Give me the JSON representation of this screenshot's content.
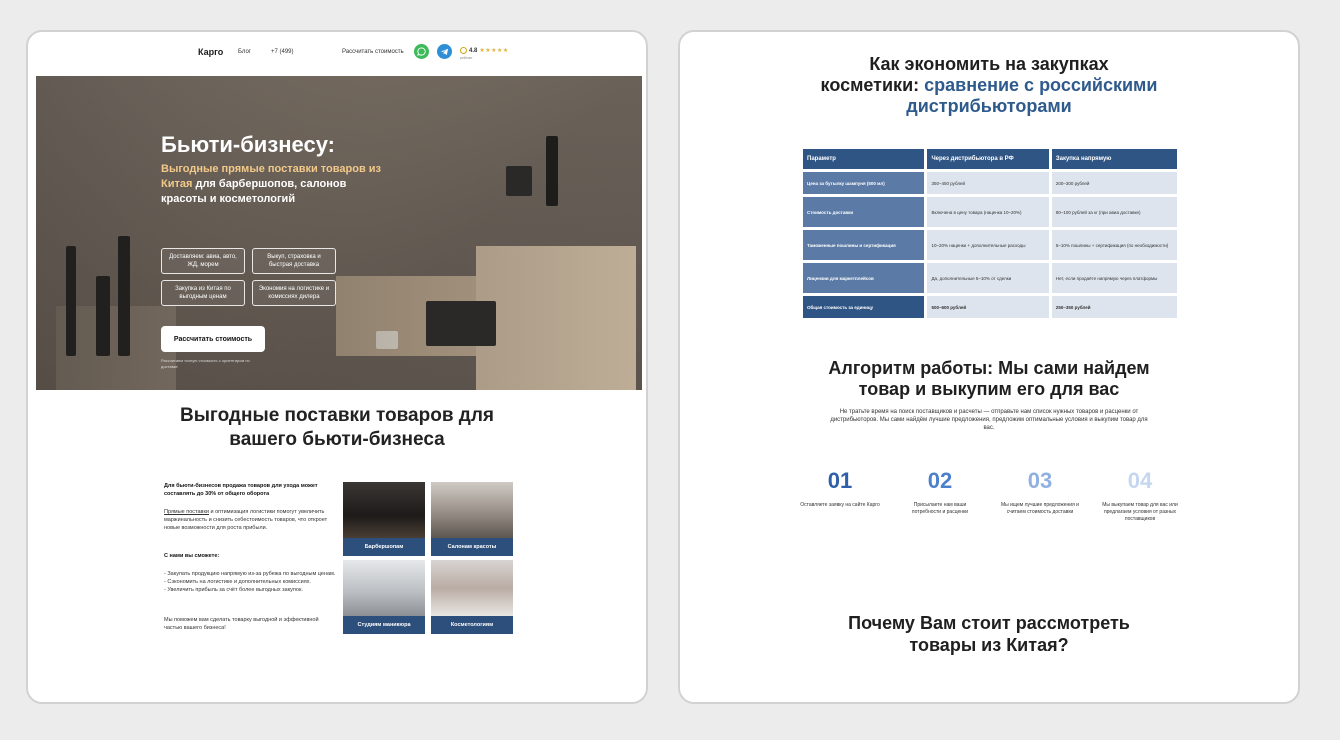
{
  "left": {
    "header": {
      "logo": "Карго",
      "nav_blog": "Блог",
      "nav_phone": "+7 (499)",
      "nav_calc": "Рассчитать стоимость",
      "rating_value": "4.8",
      "rating_stars": "★★★★★",
      "rating_note": "рейтинг",
      "whatsapp_icon": "whatsapp-icon",
      "telegram_icon": "telegram-icon"
    },
    "hero": {
      "title": "Бьюти-бизнесу:",
      "subtitle_highlight": "Выгодные прямые поставки товаров из Китая",
      "subtitle_rest": " для барбершопов, салонов красоты и косметологий",
      "pills": [
        "Доставляем: авиа, авто, ЖД, морем",
        "Выкуп, страховка и быстрая доставка",
        "Закупка из Китая по выгодным ценам",
        "Экономия на логистике и комиссиях дилера"
      ],
      "cta": "Рассчитать стоимость",
      "note": "Рассчитаем точную стоимость с ориентиром по доставке"
    },
    "section": {
      "title_line1": "Выгодные поставки товаров для",
      "title_line2": "вашего бьюти-бизнеса",
      "lead": "Для бьюти-бизнесов продажа товаров для ухода может составлять до 30% от общего оборота",
      "p1_link": "Прямые поставки",
      "p1_rest": " и оптимизация логистики помогут увеличить маржинальность и снизить себестоимость товаров, что откроет новые возможности для роста прибыли.",
      "can_title": "С нами вы сможете:",
      "can_items": [
        "- Закупать продукцию напрямую из-за рубежа по выгодным ценам.",
        "- Сэкономить на логистике и дополнительных комиссиях.",
        "- Увеличить прибыль за счёт более выгодных закупок."
      ],
      "closing": "Мы поможем вам сделать товарку выгодной и эффективной частью вашего бизнеса!",
      "tiles": [
        "Барбершопам",
        "Салонам красоты",
        "Студиям маникюра",
        "Косметологиям"
      ]
    }
  },
  "right": {
    "title_dark": "Как экономить на закупках косметики: ",
    "title_blue": "сравнение с российскими дистрибьюторами",
    "table": {
      "headers": [
        "Параметр",
        "Через дистрибьютора в РФ",
        "Закупка напрямую"
      ],
      "rows": [
        [
          "Цена за бутылку шампуня (500 мл)",
          "350–450 рублей",
          "200–300 рублей"
        ],
        [
          "Стоимость доставки",
          "Включена в цену товара (наценка 10–20%)",
          "80–100 рублей за кг (при авиа доставке)"
        ],
        [
          "Таможенные пошлины и сертификация",
          "10–20% наценки + дополнительные расходы",
          "5–10% пошлины + сертификация (по необходимости)"
        ],
        [
          "Лицензии для маркетплейсов",
          "Да, дополнительные 5–10% от сделки",
          "Нет, если продаёте напрямую через платформы"
        ],
        [
          "Общая стоимость за единицу",
          "500–600 рублей",
          "250–350 рублей"
        ]
      ]
    },
    "algo": {
      "title_line1": "Алгоритм работы: Мы сами найдем",
      "title_line2": "товар и выкупим его для вас",
      "desc": "Не тратьте время на поиск поставщиков и расчеты — отправьте нам список нужных товаров и расценки от дистрибьюторов. Мы сами найдём лучшие предложения, предложим оптимальные условия и выкупим товар для вас.",
      "steps": [
        {
          "num": "01",
          "text": "Оставляете заявку на сайте Карго",
          "color": "#2e5fa8"
        },
        {
          "num": "02",
          "text": "Присылаете нам ваши потребности и расценки",
          "color": "#4d80cc"
        },
        {
          "num": "03",
          "text": "Мы ищем лучшие предложения и считаем стоимость доставки",
          "color": "#8fb0e0"
        },
        {
          "num": "04",
          "text": "Мы выкупаем товар для вас или предлагаем условия от разных поставщиков",
          "color": "#c5d6ef"
        }
      ]
    },
    "why_line1": "Почему Вам стоит рассмотреть",
    "why_line2": "товары из Китая?"
  }
}
